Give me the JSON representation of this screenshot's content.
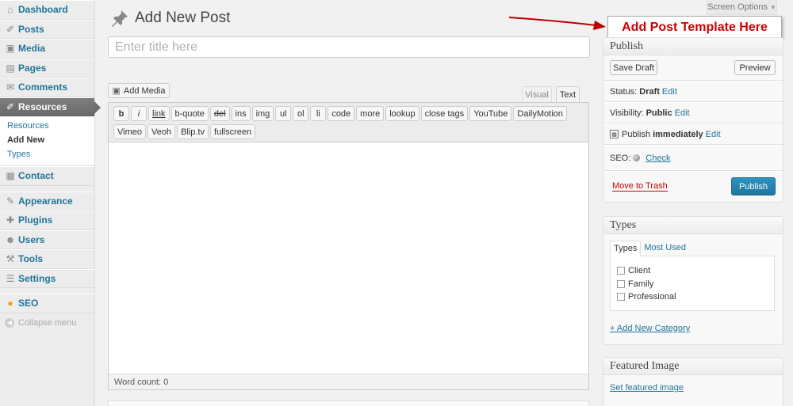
{
  "sidebar": {
    "items_top": [
      {
        "label": "Dashboard",
        "icon": "dashboard-icon"
      },
      {
        "label": "Posts",
        "icon": "pin-icon"
      },
      {
        "label": "Media",
        "icon": "media-icon"
      },
      {
        "label": "Pages",
        "icon": "pages-icon"
      },
      {
        "label": "Comments",
        "icon": "comments-icon"
      },
      {
        "label": "Resources",
        "icon": "pin-icon"
      }
    ],
    "submenu": [
      "Resources",
      "Add New",
      "Types"
    ],
    "items_mid": [
      {
        "label": "Contact",
        "icon": "contact-icon"
      }
    ],
    "items_bottom": [
      {
        "label": "Appearance",
        "icon": "appearance-icon"
      },
      {
        "label": "Plugins",
        "icon": "plugins-icon"
      },
      {
        "label": "Users",
        "icon": "users-icon"
      },
      {
        "label": "Tools",
        "icon": "tools-icon"
      },
      {
        "label": "Settings",
        "icon": "settings-icon"
      }
    ],
    "seo": {
      "label": "SEO",
      "icon": "seo-icon"
    },
    "collapse": "Collapse menu"
  },
  "header": {
    "screen_options": "Screen Options",
    "page_title": "Add New Post"
  },
  "annotation": {
    "text": "Add Post Template Here",
    "color": "#cc0000"
  },
  "editor": {
    "title_placeholder": "Enter title here",
    "add_media": "Add Media",
    "tab_visual": "Visual",
    "tab_text": "Text",
    "quicktags": [
      "b",
      "i",
      "link",
      "b-quote",
      "del",
      "ins",
      "img",
      "ul",
      "ol",
      "li",
      "code",
      "more",
      "lookup",
      "close tags",
      "YouTube",
      "DailyMotion",
      "Vimeo",
      "Veoh",
      "Blip.tv",
      "fullscreen"
    ],
    "word_count": "Word count: 0"
  },
  "publish": {
    "title": "Publish",
    "save_draft": "Save Draft",
    "preview": "Preview",
    "status_label": "Status:",
    "status_value": "Draft",
    "visibility_label": "Visibility:",
    "visibility_value": "Public",
    "publish_label": "Publish",
    "publish_value": "immediately",
    "edit": "Edit",
    "seo_label": "SEO:",
    "seo_check": "Check",
    "move_to_trash": "Move to Trash",
    "publish_button": "Publish",
    "accent": "#21759b"
  },
  "types": {
    "title": "Types",
    "tabs": [
      "Types",
      "Most Used"
    ],
    "items": [
      "Client",
      "Family",
      "Professional"
    ],
    "add_new": "+ Add New Category"
  },
  "featured": {
    "title": "Featured Image",
    "link": "Set featured image"
  }
}
